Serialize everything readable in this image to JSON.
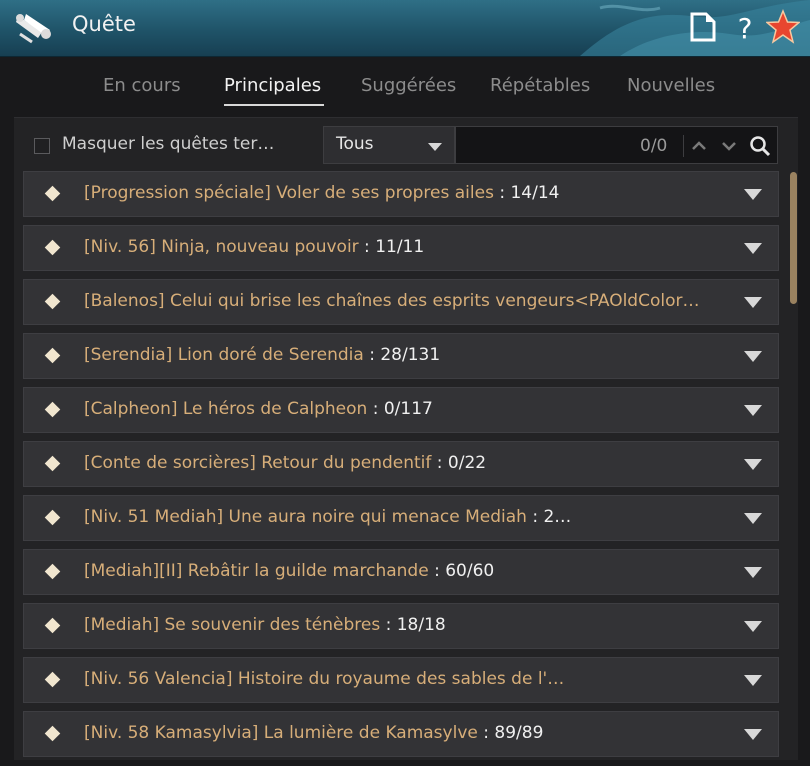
{
  "window": {
    "title": "Quête"
  },
  "tabs": [
    {
      "label": "En cours"
    },
    {
      "label": "Principales"
    },
    {
      "label": "Suggérées"
    },
    {
      "label": "Répétables"
    },
    {
      "label": "Nouvelles"
    }
  ],
  "toolbar": {
    "hide_completed_label": "Masquer les quêtes ter…",
    "filter_selected": "Tous",
    "search_value": "",
    "search_count": "0/0"
  },
  "quests": [
    {
      "title": "[Progression spéciale] Voler de ses propres ailes",
      "progress": " : 14/14"
    },
    {
      "title": "[Niv. 56] Ninja, nouveau pouvoir",
      "progress": " : 11/11"
    },
    {
      "title": "[Balenos] Celui qui brise les chaînes des esprits vengeurs<PAOldColor…",
      "progress": ""
    },
    {
      "title": "[Serendia] Lion doré de Serendia",
      "progress": " : 28/131"
    },
    {
      "title": "[Calpheon] Le héros de Calpheon",
      "progress": " : 0/117"
    },
    {
      "title": "[Conte de sorcières] Retour du pendentif",
      "progress": " : 0/22"
    },
    {
      "title": "[Niv. 51 Mediah] Une aura noire qui menace Mediah",
      "progress": " : 2…"
    },
    {
      "title": "[Mediah][II] Rebâtir la guilde marchande",
      "progress": " : 60/60"
    },
    {
      "title": "[Mediah] Se souvenir des ténèbres",
      "progress": " : 18/18"
    },
    {
      "title": "[Niv. 56 Valencia] Histoire du royaume des sables de l'…",
      "progress": ""
    },
    {
      "title": "[Niv. 58 Kamasylvia] La lumière de Kamasylve",
      "progress": " : 89/89"
    }
  ],
  "colors": {
    "titlebar": "#1f5368",
    "quest_title": "#d7ae79",
    "accent_star": "#e8462f",
    "scroll_thumb": "#9a8260"
  },
  "icons": {
    "title": "scroll-quest-icon",
    "doc": "document-icon",
    "help": "help-icon",
    "star": "star-icon",
    "search": "search-icon"
  }
}
